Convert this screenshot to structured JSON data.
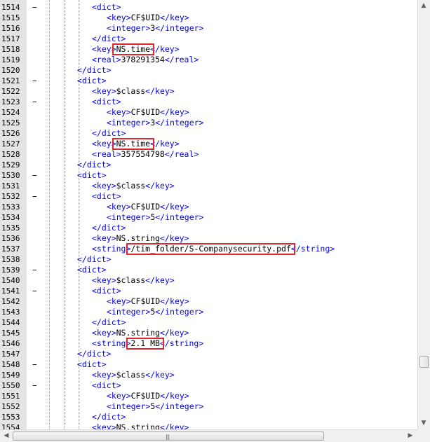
{
  "editor": {
    "lines": [
      {
        "n": "1514",
        "fold": "−",
        "indent": 3,
        "parts": [
          {
            "t": "<dict>"
          }
        ]
      },
      {
        "n": "1515",
        "fold": "",
        "indent": 4,
        "parts": [
          {
            "t": "<key>"
          },
          {
            "v": "CF$UID"
          },
          {
            "t": "</key>"
          }
        ]
      },
      {
        "n": "1516",
        "fold": "",
        "indent": 4,
        "parts": [
          {
            "t": "<integer>"
          },
          {
            "v": "3"
          },
          {
            "t": "</integer>"
          }
        ]
      },
      {
        "n": "1517",
        "fold": "",
        "indent": 3,
        "parts": [
          {
            "t": "</dict>"
          }
        ]
      },
      {
        "n": "1518",
        "fold": "",
        "indent": 3,
        "parts": [
          {
            "t": "<key>"
          },
          {
            "v": "NS.time"
          },
          {
            "t": "</key>"
          }
        ]
      },
      {
        "n": "1519",
        "fold": "",
        "indent": 3,
        "parts": [
          {
            "t": "<real>"
          },
          {
            "v": "378291354"
          },
          {
            "t": "</real>"
          }
        ]
      },
      {
        "n": "1520",
        "fold": "",
        "indent": 2,
        "parts": [
          {
            "t": "</dict>"
          }
        ]
      },
      {
        "n": "1521",
        "fold": "−",
        "indent": 2,
        "parts": [
          {
            "t": "<dict>"
          }
        ]
      },
      {
        "n": "1522",
        "fold": "",
        "indent": 3,
        "parts": [
          {
            "t": "<key>"
          },
          {
            "v": "$class"
          },
          {
            "t": "</key>"
          }
        ]
      },
      {
        "n": "1523",
        "fold": "−",
        "indent": 3,
        "parts": [
          {
            "t": "<dict>"
          }
        ]
      },
      {
        "n": "1524",
        "fold": "",
        "indent": 4,
        "parts": [
          {
            "t": "<key>"
          },
          {
            "v": "CF$UID"
          },
          {
            "t": "</key>"
          }
        ]
      },
      {
        "n": "1525",
        "fold": "",
        "indent": 4,
        "parts": [
          {
            "t": "<integer>"
          },
          {
            "v": "3"
          },
          {
            "t": "</integer>"
          }
        ]
      },
      {
        "n": "1526",
        "fold": "",
        "indent": 3,
        "parts": [
          {
            "t": "</dict>"
          }
        ]
      },
      {
        "n": "1527",
        "fold": "",
        "indent": 3,
        "parts": [
          {
            "t": "<key>"
          },
          {
            "v": "NS.time"
          },
          {
            "t": "</key>"
          }
        ]
      },
      {
        "n": "1528",
        "fold": "",
        "indent": 3,
        "parts": [
          {
            "t": "<real>"
          },
          {
            "v": "357554798"
          },
          {
            "t": "</real>"
          }
        ]
      },
      {
        "n": "1529",
        "fold": "",
        "indent": 2,
        "parts": [
          {
            "t": "</dict>"
          }
        ]
      },
      {
        "n": "1530",
        "fold": "−",
        "indent": 2,
        "parts": [
          {
            "t": "<dict>"
          }
        ]
      },
      {
        "n": "1531",
        "fold": "",
        "indent": 3,
        "parts": [
          {
            "t": "<key>"
          },
          {
            "v": "$class"
          },
          {
            "t": "</key>"
          }
        ]
      },
      {
        "n": "1532",
        "fold": "−",
        "indent": 3,
        "parts": [
          {
            "t": "<dict>"
          }
        ]
      },
      {
        "n": "1533",
        "fold": "",
        "indent": 4,
        "parts": [
          {
            "t": "<key>"
          },
          {
            "v": "CF$UID"
          },
          {
            "t": "</key>"
          }
        ]
      },
      {
        "n": "1534",
        "fold": "",
        "indent": 4,
        "parts": [
          {
            "t": "<integer>"
          },
          {
            "v": "5"
          },
          {
            "t": "</integer>"
          }
        ]
      },
      {
        "n": "1535",
        "fold": "",
        "indent": 3,
        "parts": [
          {
            "t": "</dict>"
          }
        ]
      },
      {
        "n": "1536",
        "fold": "",
        "indent": 3,
        "parts": [
          {
            "t": "<key>"
          },
          {
            "v": "NS.string"
          },
          {
            "t": "</key>"
          }
        ]
      },
      {
        "n": "1537",
        "fold": "",
        "indent": 3,
        "parts": [
          {
            "t": "<string>"
          },
          {
            "v": "/tim_folder/S-Companysecurity.pdf"
          },
          {
            "t": "</string>"
          }
        ]
      },
      {
        "n": "1538",
        "fold": "",
        "indent": 2,
        "parts": [
          {
            "t": "</dict>"
          }
        ]
      },
      {
        "n": "1539",
        "fold": "−",
        "indent": 2,
        "parts": [
          {
            "t": "<dict>"
          }
        ]
      },
      {
        "n": "1540",
        "fold": "",
        "indent": 3,
        "parts": [
          {
            "t": "<key>"
          },
          {
            "v": "$class"
          },
          {
            "t": "</key>"
          }
        ]
      },
      {
        "n": "1541",
        "fold": "−",
        "indent": 3,
        "parts": [
          {
            "t": "<dict>"
          }
        ]
      },
      {
        "n": "1542",
        "fold": "",
        "indent": 4,
        "parts": [
          {
            "t": "<key>"
          },
          {
            "v": "CF$UID"
          },
          {
            "t": "</key>"
          }
        ]
      },
      {
        "n": "1543",
        "fold": "",
        "indent": 4,
        "parts": [
          {
            "t": "<integer>"
          },
          {
            "v": "5"
          },
          {
            "t": "</integer>"
          }
        ]
      },
      {
        "n": "1544",
        "fold": "",
        "indent": 3,
        "parts": [
          {
            "t": "</dict>"
          }
        ]
      },
      {
        "n": "1545",
        "fold": "",
        "indent": 3,
        "parts": [
          {
            "t": "<key>"
          },
          {
            "v": "NS.string"
          },
          {
            "t": "</key>"
          }
        ]
      },
      {
        "n": "1546",
        "fold": "",
        "indent": 3,
        "parts": [
          {
            "t": "<string>"
          },
          {
            "v": "2.1 MB"
          },
          {
            "t": "</string>"
          }
        ]
      },
      {
        "n": "1547",
        "fold": "",
        "indent": 2,
        "parts": [
          {
            "t": "</dict>"
          }
        ]
      },
      {
        "n": "1548",
        "fold": "−",
        "indent": 2,
        "parts": [
          {
            "t": "<dict>"
          }
        ]
      },
      {
        "n": "1549",
        "fold": "",
        "indent": 3,
        "parts": [
          {
            "t": "<key>"
          },
          {
            "v": "$class"
          },
          {
            "t": "</key>"
          }
        ]
      },
      {
        "n": "1550",
        "fold": "−",
        "indent": 3,
        "parts": [
          {
            "t": "<dict>"
          }
        ]
      },
      {
        "n": "1551",
        "fold": "",
        "indent": 4,
        "parts": [
          {
            "t": "<key>"
          },
          {
            "v": "CF$UID"
          },
          {
            "t": "</key>"
          }
        ]
      },
      {
        "n": "1552",
        "fold": "",
        "indent": 4,
        "parts": [
          {
            "t": "<integer>"
          },
          {
            "v": "5"
          },
          {
            "t": "</integer>"
          }
        ]
      },
      {
        "n": "1553",
        "fold": "",
        "indent": 3,
        "parts": [
          {
            "t": "</dict>"
          }
        ]
      },
      {
        "n": "1554",
        "fold": "",
        "indent": 3,
        "parts": [
          {
            "t": "<key>"
          },
          {
            "v": "NS.string"
          },
          {
            "t": "</key>"
          }
        ]
      }
    ],
    "highlighted_lines": [
      "1518",
      "1527",
      "1537",
      "1546"
    ]
  },
  "scrollbars": {
    "up_arrow_icon": "arrow-up-icon",
    "down_arrow_icon": "arrow-down-icon",
    "left_arrow_icon": "arrow-left-icon",
    "right_arrow_icon": "arrow-right-icon",
    "grip": "|||"
  },
  "colors": {
    "tag": "#0000ee",
    "value": "#000000",
    "highlight_box": "#d9282f",
    "gutter": "#e4e4e4"
  }
}
